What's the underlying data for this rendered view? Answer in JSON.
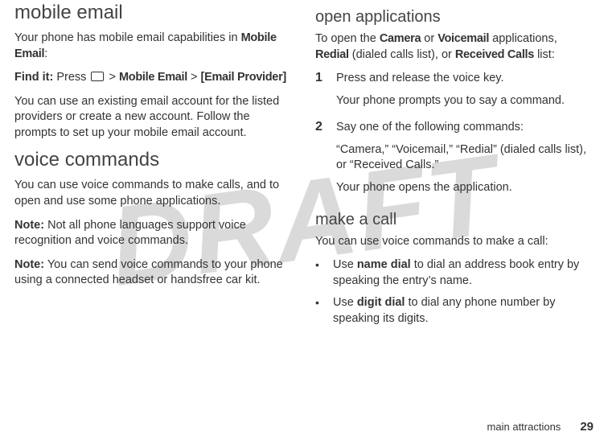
{
  "watermark": "DRAFT",
  "left": {
    "h_mobile_email": "mobile email",
    "p1a": "Your phone has mobile email capabilities in ",
    "p1b": "Mobile Email",
    "p1c": ":",
    "findit_label": "Find it:",
    "findit_press": " Press ",
    "findit_gt1": " > ",
    "findit_me": "Mobile Email",
    "findit_gt2": " > ",
    "findit_ep": "[Email Provider]",
    "p2": "You can use an existing email account for the listed providers or create a new account. Follow the prompts to set up your mobile email account.",
    "h_voice": "voice commands",
    "p3": "You can use voice commands to make calls, and to open and use some phone applications.",
    "note1_label": "Note:",
    "note1_body": " Not all phone languages support voice recognition and voice commands.",
    "note2_label": "Note:",
    "note2_body": " You can send voice commands to your phone using a connected headset or handsfree car kit."
  },
  "right": {
    "h_open": "open applications",
    "p1a": "To open the ",
    "p1b": "Camera",
    "p1c": " or ",
    "p1d": "Voicemail",
    "p1e": " applications, ",
    "p1f": "Redial",
    "p1g": " (dialed calls list), or ",
    "p1h": "Received Calls",
    "p1i": " list:",
    "step1_num": "1",
    "step1_a": "Press and release the voice key.",
    "step1_b": "Your phone prompts you to say a command.",
    "step2_num": "2",
    "step2_a": "Say one of the following commands:",
    "step2_b": "“Camera,” “Voicemail,” “Redial” (dialed calls list), or “Received Calls.”",
    "step2_c": "Your phone opens the application.",
    "h_make": "make a call",
    "p_make": "You can use voice commands to make a call:",
    "b1a": "Use ",
    "b1b": "name dial",
    "b1c": " to dial an address book entry by speaking the entry’s name.",
    "b2a": "Use ",
    "b2b": "digit dial",
    "b2c": " to dial any phone number by speaking its digits."
  },
  "footer": {
    "section": "main attractions",
    "page": "29"
  }
}
